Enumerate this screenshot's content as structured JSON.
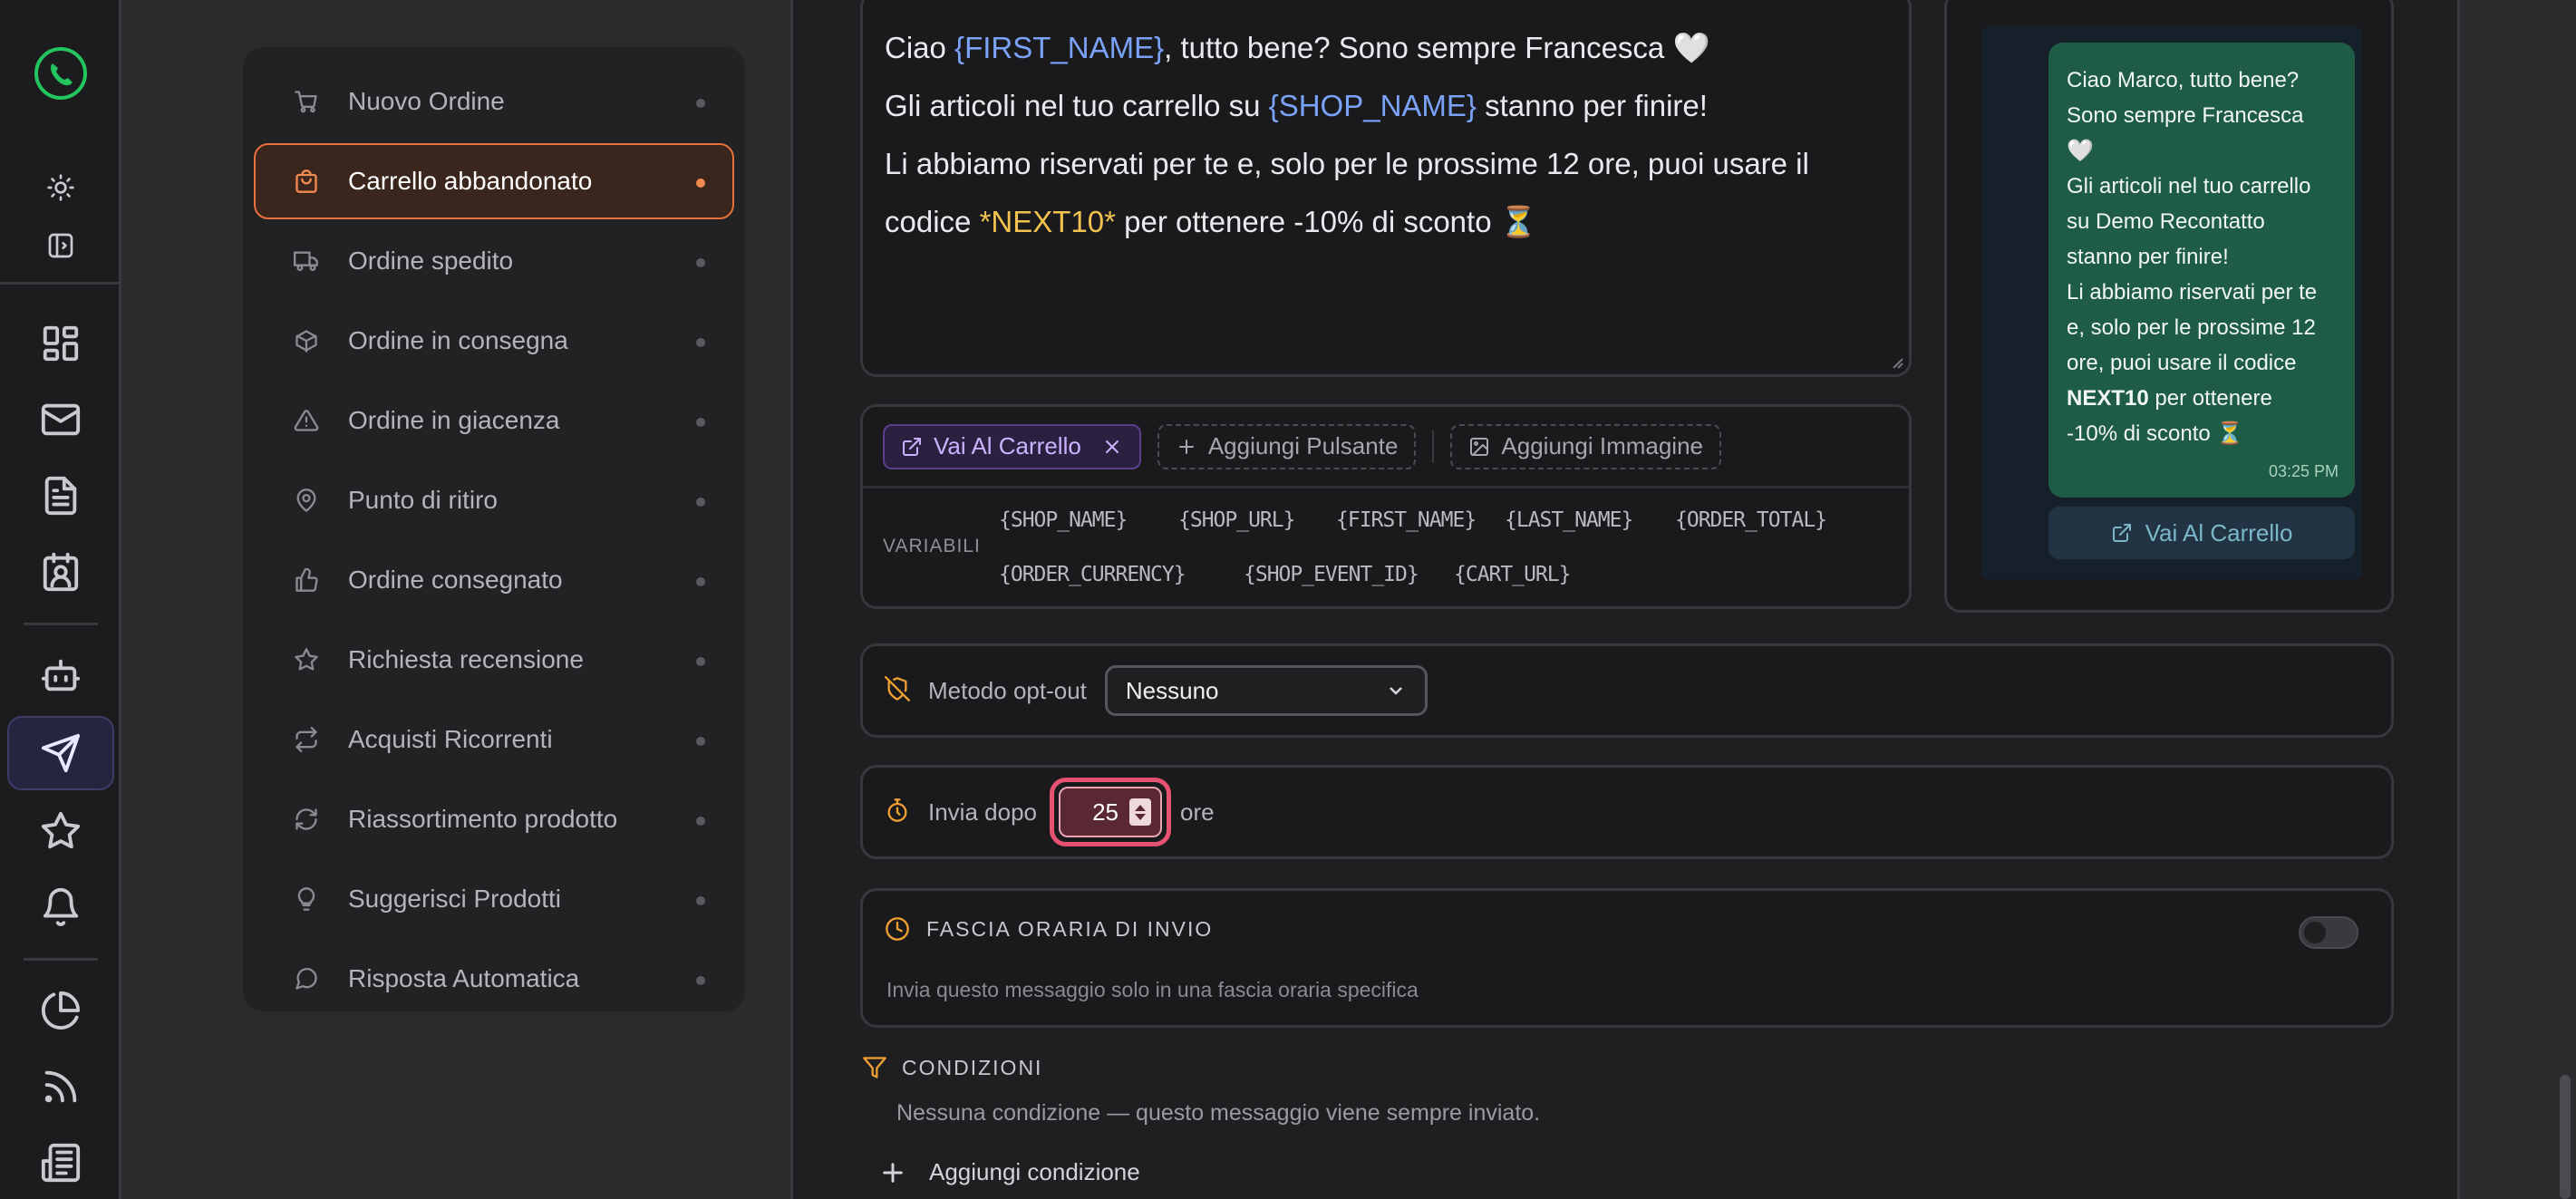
{
  "rail": {
    "icons": [
      "logo-icon",
      "sun-icon",
      "sidebar-toggle-icon",
      "dashboard-icon",
      "mail-icon",
      "document-icon",
      "contact-card-icon",
      "bot-icon",
      "send-icon",
      "star-icon",
      "bell-icon",
      "pie-chart-icon",
      "rss-icon",
      "newspaper-icon"
    ],
    "active": "send-icon"
  },
  "templates": [
    {
      "label": "Nuovo Ordine",
      "icon": "cart-icon"
    },
    {
      "label": "Carrello abbandonato",
      "icon": "shopping-bag-icon",
      "active": true
    },
    {
      "label": "Ordine spedito",
      "icon": "truck-icon"
    },
    {
      "label": "Ordine in consegna",
      "icon": "package-icon"
    },
    {
      "label": "Ordine in giacenza",
      "icon": "warning-icon"
    },
    {
      "label": "Punto di ritiro",
      "icon": "map-pin-icon"
    },
    {
      "label": "Ordine consegnato",
      "icon": "thumbs-up-icon"
    },
    {
      "label": "Richiesta recensione",
      "icon": "star-icon"
    },
    {
      "label": "Acquisti Ricorrenti",
      "icon": "repeat-icon"
    },
    {
      "label": "Riassortimento prodotto",
      "icon": "refresh-icon"
    },
    {
      "label": "Suggerisci Prodotti",
      "icon": "lightbulb-icon"
    },
    {
      "label": "Risposta Automatica",
      "icon": "chat-bubble-icon"
    }
  ],
  "message": {
    "l1_a": "Ciao ",
    "l1_var": "{FIRST_NAME}",
    "l1_b": ", tutto bene? Sono sempre Francesca 🤍",
    "l2_a": "Gli articoli nel tuo carrello su ",
    "l2_var": "{SHOP_NAME}",
    "l2_b": " stanno per finire!",
    "l3": "Li abbiamo riservati per te e, solo per le prossime 12 ore, puoi usare il",
    "l4_a": "codice ",
    "l4_bold": "*NEXT10*",
    "l4_b": " per ottenere -10% di sconto ⏳"
  },
  "buttons": {
    "cta_label": "Vai Al Carrello",
    "add_button": "Aggiungi Pulsante",
    "add_image": "Aggiungi Immagine"
  },
  "variables": {
    "label": "VARIABILI",
    "items": [
      "{SHOP_NAME}",
      "{SHOP_URL}",
      "{FIRST_NAME}",
      "{LAST_NAME}",
      "{ORDER_TOTAL}",
      "{ORDER_CURRENCY}",
      "{SHOP_EVENT_ID}",
      "{CART_URL}"
    ]
  },
  "preview": {
    "lines": [
      "Ciao Marco, tutto bene?",
      "Sono sempre Francesca",
      "🤍",
      "Gli articoli nel tuo carrello",
      "su Demo Recontatto",
      "stanno per finire!",
      "Li abbiamo riservati per te",
      "e, solo per le prossime 12",
      "ore, puoi usare il codice"
    ],
    "bold": "NEXT10",
    "after_bold": " per ottenere",
    "last": "-10% di sconto ⏳",
    "time": "03:25 PM",
    "button": "Vai Al Carrello"
  },
  "optout": {
    "label": "Metodo opt-out",
    "value": "Nessuno"
  },
  "delay": {
    "label": "Invia dopo",
    "value": "25",
    "unit": "ore"
  },
  "fascia": {
    "title": "FASCIA ORARIA DI INVIO",
    "desc": "Invia questo messaggio solo in una fascia oraria specifica",
    "enabled": false
  },
  "conditions": {
    "title": "CONDIZIONI",
    "desc": "Nessuna condizione — questo messaggio viene sempre inviato.",
    "add": "Aggiungi condizione"
  },
  "colors": {
    "accent": "#e8703a",
    "highlight": "#e65372",
    "bubble": "#1f5c46",
    "brand": "#22c55e"
  }
}
